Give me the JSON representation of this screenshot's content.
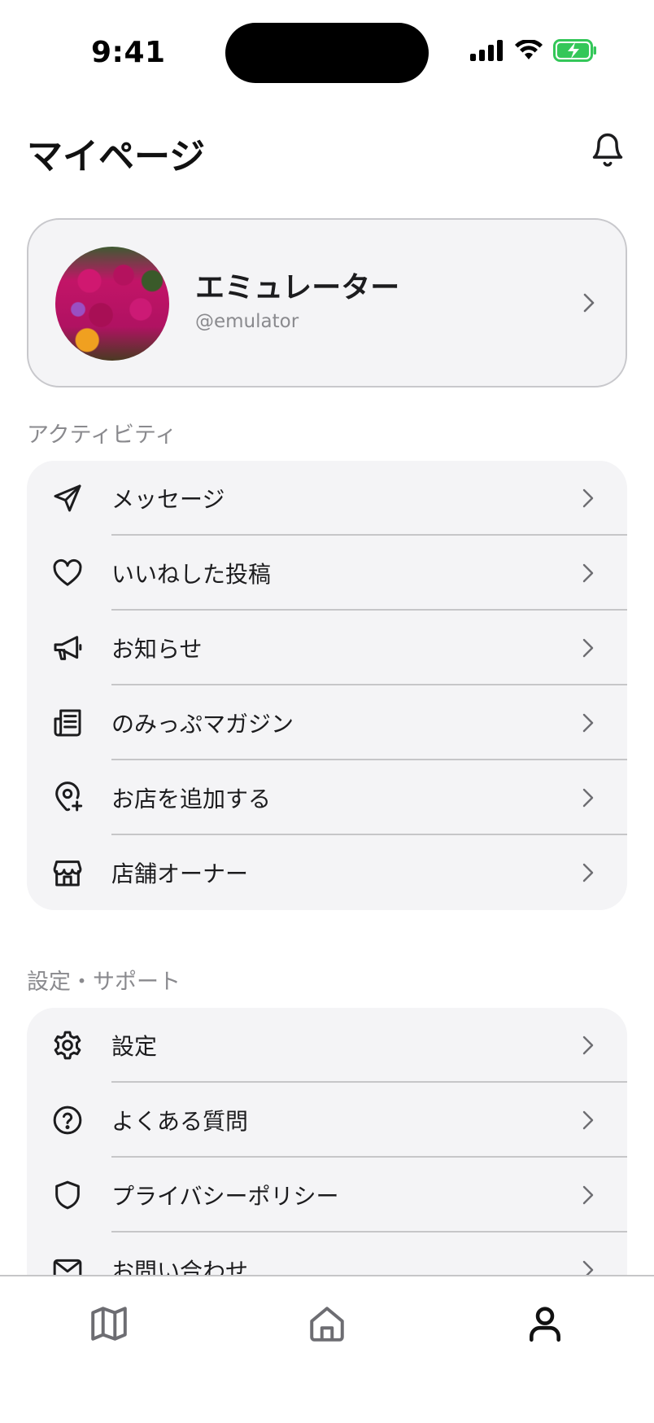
{
  "status_bar": {
    "time": "9:41"
  },
  "header": {
    "title": "マイページ"
  },
  "profile": {
    "name": "エミュレーター",
    "handle": "@emulator"
  },
  "sections": {
    "activity": {
      "label": "アクティビティ",
      "items": [
        {
          "label": "メッセージ",
          "icon": "send-icon"
        },
        {
          "label": "いいねした投稿",
          "icon": "heart-icon"
        },
        {
          "label": "お知らせ",
          "icon": "megaphone-icon"
        },
        {
          "label": "のみっぷマガジン",
          "icon": "newspaper-icon"
        },
        {
          "label": "お店を追加する",
          "icon": "map-pin-plus-icon"
        },
        {
          "label": "店舗オーナー",
          "icon": "store-icon"
        }
      ]
    },
    "support": {
      "label": "設定・サポート",
      "items": [
        {
          "label": "設定",
          "icon": "gear-icon"
        },
        {
          "label": "よくある質問",
          "icon": "help-circle-icon"
        },
        {
          "label": "プライバシーポリシー",
          "icon": "shield-icon"
        },
        {
          "label": "お問い合わせ",
          "icon": "mail-icon"
        }
      ]
    }
  },
  "tab_bar": {
    "tabs": [
      {
        "name": "map",
        "icon": "map-icon"
      },
      {
        "name": "home",
        "icon": "home-icon"
      },
      {
        "name": "mypage",
        "icon": "user-icon",
        "active": true
      }
    ]
  },
  "colors": {
    "icon": "#1c1c1e",
    "muted": "#8a8a8e",
    "card": "#f4f4f6",
    "battery": "#34c759"
  }
}
